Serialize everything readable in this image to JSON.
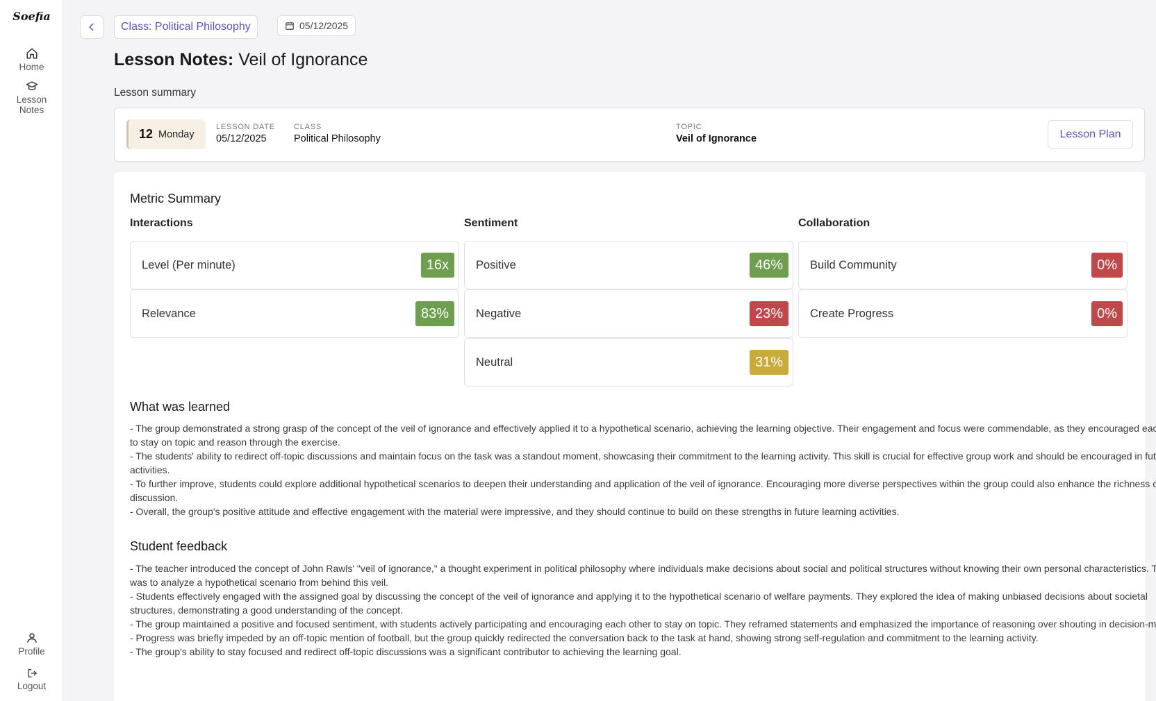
{
  "app": {
    "logo": "Soefia"
  },
  "sidebar": {
    "home": "Home",
    "lesson_notes_1": "Lesson",
    "lesson_notes_2": "Notes",
    "profile": "Profile",
    "logout": "Logout"
  },
  "header": {
    "class_chip": "Class: Political Philosophy",
    "date_chip": "05/12/2025",
    "title_bold": "Lesson Notes:",
    "title_rest": " Veil of Ignorance"
  },
  "summary": {
    "label": "Lesson summary",
    "day_num": "12",
    "day_name": "Monday",
    "lesson_date_key": "Lesson date",
    "lesson_date": "05/12/2025",
    "class_key": "Class",
    "class": "Political Philosophy",
    "topic_key": "Topic",
    "topic": "Veil of Ignorance",
    "lesson_plan_button": "Lesson Plan"
  },
  "metrics": {
    "title": "Metric Summary",
    "interactions": {
      "title": "Interactions",
      "items": [
        {
          "label": "Level (Per minute)",
          "value": "16x",
          "color": "#6e9f4e"
        },
        {
          "label": "Relevance",
          "value": "83%",
          "color": "#6e9f4e"
        }
      ]
    },
    "sentiment": {
      "title": "Sentiment",
      "items": [
        {
          "label": "Positive",
          "value": "46%",
          "color": "#6e9f4e"
        },
        {
          "label": "Negative",
          "value": "23%",
          "color": "#c0474a"
        },
        {
          "label": "Neutral",
          "value": "31%",
          "color": "#c9ab3a"
        }
      ]
    },
    "collaboration": {
      "title": "Collaboration",
      "items": [
        {
          "label": "Build Community",
          "value": "0%",
          "color": "#c0474a"
        },
        {
          "label": "Create Progress",
          "value": "0%",
          "color": "#c0474a"
        }
      ]
    }
  },
  "learned": {
    "title": "What was learned",
    "lines": [
      "- The group demonstrated a strong grasp of the concept of the veil of ignorance and effectively applied it to a hypothetical scenario, achieving the learning objective. Their engagement and focus were commendable, as they encouraged each other to stay on topic and reason through the exercise.",
      "- The students' ability to redirect off-topic discussions and maintain focus on the task was a standout moment, showcasing their commitment to the learning activity. This skill is crucial for effective group work and should be encouraged in future activities.",
      "- To further improve, students could explore additional hypothetical scenarios to deepen their understanding and application of the veil of ignorance. Encouraging more diverse perspectives within the group could also enhance the richness of the discussion.",
      "- Overall, the group's positive attitude and effective engagement with the material were impressive, and they should continue to build on these strengths in future learning activities."
    ]
  },
  "feedback": {
    "title": "Student feedback",
    "lines": [
      "- The teacher introduced the concept of John Rawls' \"veil of ignorance,\" a thought experiment in political philosophy where individuals make decisions about social and political structures without knowing their own personal characteristics. The goal was to analyze a hypothetical scenario from behind this veil.",
      "- Students effectively engaged with the assigned goal by discussing the concept of the veil of ignorance and applying it to the hypothetical scenario of welfare payments. They explored the idea of making unbiased decisions about societal structures, demonstrating a good understanding of the concept.",
      "- The group maintained a positive and focused sentiment, with students actively participating and encouraging each other to stay on topic. They reframed statements and emphasized the importance of reasoning over shouting in decision-making.",
      "- Progress was briefly impeded by an off-topic mention of football, but the group quickly redirected the conversation back to the task at hand, showing strong self-regulation and commitment to the learning activity.",
      "- The group's ability to stay focused and redirect off-topic discussions was a significant contributor to achieving the learning goal."
    ]
  }
}
